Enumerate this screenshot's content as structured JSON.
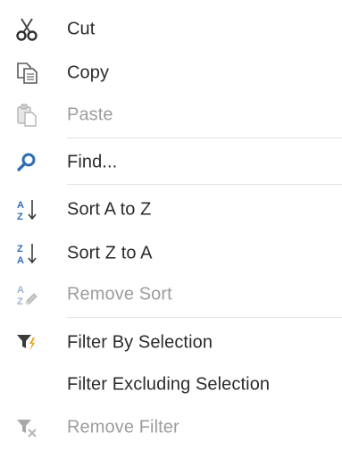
{
  "menu": {
    "items": [
      {
        "key": "cut",
        "label": "Cut",
        "icon": "scissors-icon",
        "enabled": true
      },
      {
        "key": "copy",
        "label": "Copy",
        "icon": "copy-icon",
        "enabled": true
      },
      {
        "key": "paste",
        "label": "Paste",
        "icon": "paste-icon",
        "enabled": false
      },
      {
        "key": "find",
        "label": "Find...",
        "icon": "magnifier-icon",
        "enabled": true
      },
      {
        "key": "sort-a-z",
        "label": "Sort A to Z",
        "icon": "sort-ascending-icon",
        "enabled": true
      },
      {
        "key": "sort-z-a",
        "label": "Sort Z to A",
        "icon": "sort-descending-icon",
        "enabled": true
      },
      {
        "key": "remove-sort",
        "label": "Remove Sort",
        "icon": "remove-sort-icon",
        "enabled": false
      },
      {
        "key": "filter-by-selection",
        "label": "Filter By Selection",
        "icon": "filter-lightning-icon",
        "enabled": true
      },
      {
        "key": "filter-excluding-selection",
        "label": "Filter Excluding Selection",
        "icon": "",
        "enabled": true
      },
      {
        "key": "remove-filter",
        "label": "Remove Filter",
        "icon": "remove-filter-icon",
        "enabled": false
      }
    ]
  },
  "colors": {
    "text": "#2b2b2b",
    "disabled_text": "#9d9d9d",
    "separator": "#e3e3e3",
    "accent_blue": "#2e6db4",
    "accent_orange": "#f0a31a"
  }
}
